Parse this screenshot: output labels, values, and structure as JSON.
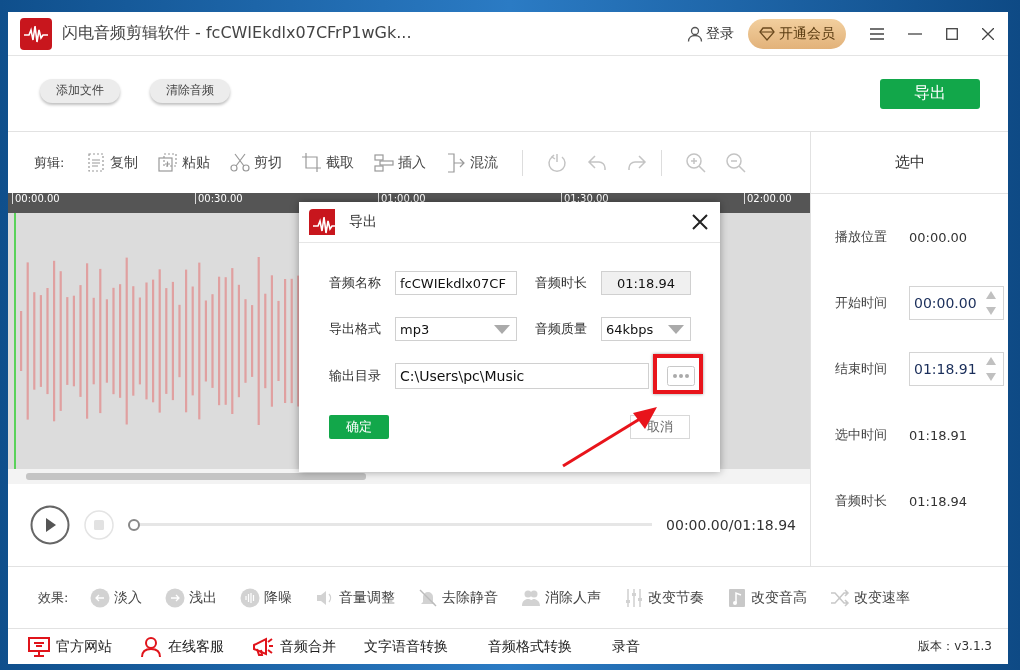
{
  "window": {
    "title": "闪电音频剪辑软件 - fcCWIEkdlx07CFrP1wGk...",
    "login": "登录",
    "vip_button": "开通会员"
  },
  "toolbar": {
    "buttons": [
      "添加文件",
      "清除音频"
    ],
    "export_button": "导出"
  },
  "edit_toolbar": {
    "label": "剪辑:",
    "tools": [
      "复制",
      "粘贴",
      "剪切",
      "截取",
      "插入",
      "混流"
    ]
  },
  "timeline": {
    "ticks": [
      "00:00.00",
      "00:30.00",
      "01:00.00",
      "01:30.00",
      "02:00.00"
    ]
  },
  "player": {
    "level": 0,
    "time": "00:00.00/01:18.94"
  },
  "side_panel": {
    "title": "选中",
    "rows": [
      {
        "kind": "text",
        "label": "播放位置",
        "value": "00:00.00"
      },
      {
        "kind": "spin",
        "label": "开始时间",
        "value": "00:00.00"
      },
      {
        "kind": "spin",
        "label": "结束时间",
        "value": "01:18.91"
      },
      {
        "kind": "text",
        "label": "选中时间",
        "value": "01:18.91"
      },
      {
        "kind": "text",
        "label": "音频时长",
        "value": "01:18.94"
      }
    ]
  },
  "effects": {
    "label": "效果:",
    "items": [
      "淡入",
      "浅出",
      "降噪",
      "音量调整",
      "去除静音",
      "消除人声",
      "改变节奏",
      "改变音高",
      "改变速率"
    ]
  },
  "footer": {
    "links": [
      {
        "kind": "icon",
        "label": "官方网站"
      },
      {
        "kind": "icon",
        "label": "在线客服"
      },
      {
        "kind": "icon",
        "label": "音频合并"
      },
      {
        "kind": "plain",
        "label": "文字语音转换"
      },
      {
        "kind": "plain",
        "label": "音频格式转换"
      },
      {
        "kind": "plain",
        "label": "录音"
      }
    ],
    "version": "版本：v3.1.3"
  },
  "dialog": {
    "title": "导出",
    "fields": [
      {
        "kind": "input",
        "label": "音频名称",
        "value": "fcCWIEkdlx07CF"
      },
      {
        "kind": "readonly",
        "label": "音频时长",
        "value": "01:18.94"
      },
      {
        "kind": "select",
        "label": "导出格式",
        "value": "mp3"
      },
      {
        "kind": "select",
        "label": "音频质量",
        "value": "64kbps"
      }
    ],
    "output_dir": {
      "label": "输出目录",
      "value": "C:\\Users\\pc\\Music"
    },
    "ok_button": "确定",
    "cancel_button": "取消"
  }
}
